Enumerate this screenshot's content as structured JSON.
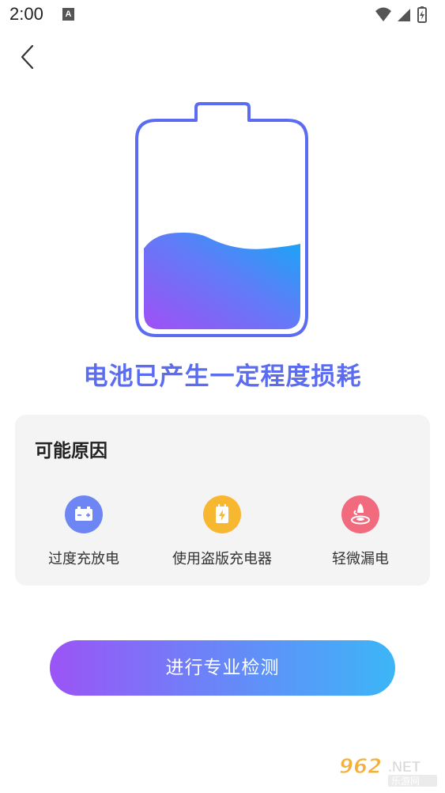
{
  "status_bar": {
    "time": "2:00",
    "notification_icon": "A",
    "icons": [
      "wifi-icon",
      "signal-icon",
      "battery-charging-icon"
    ]
  },
  "nav": {
    "back_icon": "chevron-left-icon"
  },
  "battery": {
    "fill_level": 0.38,
    "outline_color": "#5b6cf0",
    "fill_gradient": [
      "#a04ff5",
      "#12a9f6"
    ]
  },
  "headline": "电池已产生一定程度损耗",
  "causes": {
    "title": "可能原因",
    "items": [
      {
        "label": "过度充放电",
        "icon": "car-battery-icon",
        "color": "#6e86f4"
      },
      {
        "label": "使用盗版充电器",
        "icon": "charger-bolt-icon",
        "color": "#f7b731"
      },
      {
        "label": "轻微漏电",
        "icon": "leak-drop-icon",
        "color": "#f16a7e"
      }
    ]
  },
  "cta": {
    "label": "进行专业检测"
  },
  "colors": {
    "accent": "#5b6cf0",
    "card_bg": "#f4f4f4",
    "cta_gradient": [
      "#9b54f6",
      "#3cb6f7"
    ]
  }
}
